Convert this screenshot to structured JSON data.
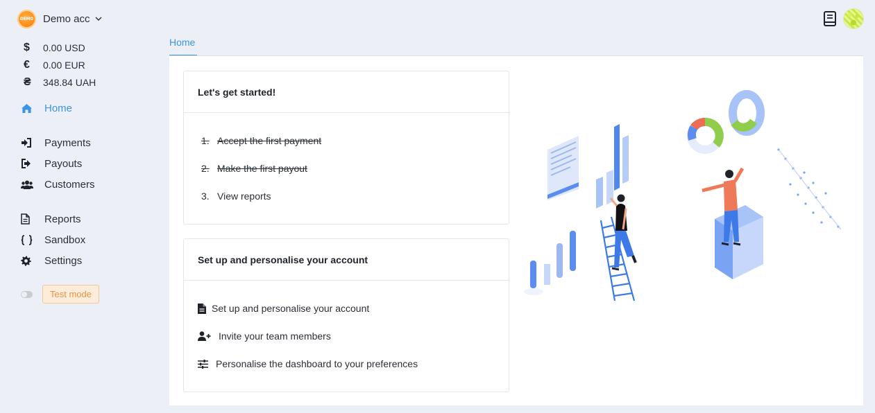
{
  "account": {
    "name": "Demo acc",
    "logo_text": "DEMO"
  },
  "balances": [
    {
      "symbol": "$",
      "value": "0.00 USD"
    },
    {
      "symbol": "€",
      "value": "0.00 EUR"
    },
    {
      "symbol": "₴",
      "value": "348.84 UAH"
    }
  ],
  "nav": {
    "home": "Home",
    "payments": "Payments",
    "payouts": "Payouts",
    "customers": "Customers",
    "reports": "Reports",
    "sandbox": "Sandbox",
    "settings": "Settings"
  },
  "test_mode": {
    "label": "Test mode",
    "enabled": false
  },
  "tabs": [
    {
      "label": "Home",
      "active": true
    }
  ],
  "getting_started": {
    "title": "Let's get started!",
    "steps": [
      {
        "num": "1.",
        "label": "Accept the first payment",
        "done": true
      },
      {
        "num": "2.",
        "label": "Make the first payout",
        "done": true
      },
      {
        "num": "3.",
        "label": "View reports",
        "done": false
      }
    ]
  },
  "setup": {
    "title": "Set up and personalise your account",
    "items": [
      {
        "icon": "document-icon",
        "label": "Set up and personalise your account"
      },
      {
        "icon": "user-plus-icon",
        "label": "Invite your team members"
      },
      {
        "icon": "sliders-icon",
        "label": "Personalise the dashboard to your preferences"
      }
    ]
  },
  "colors": {
    "accent": "#3d95e6",
    "badge_bg": "#fdecd9",
    "badge_text": "#e79445"
  }
}
